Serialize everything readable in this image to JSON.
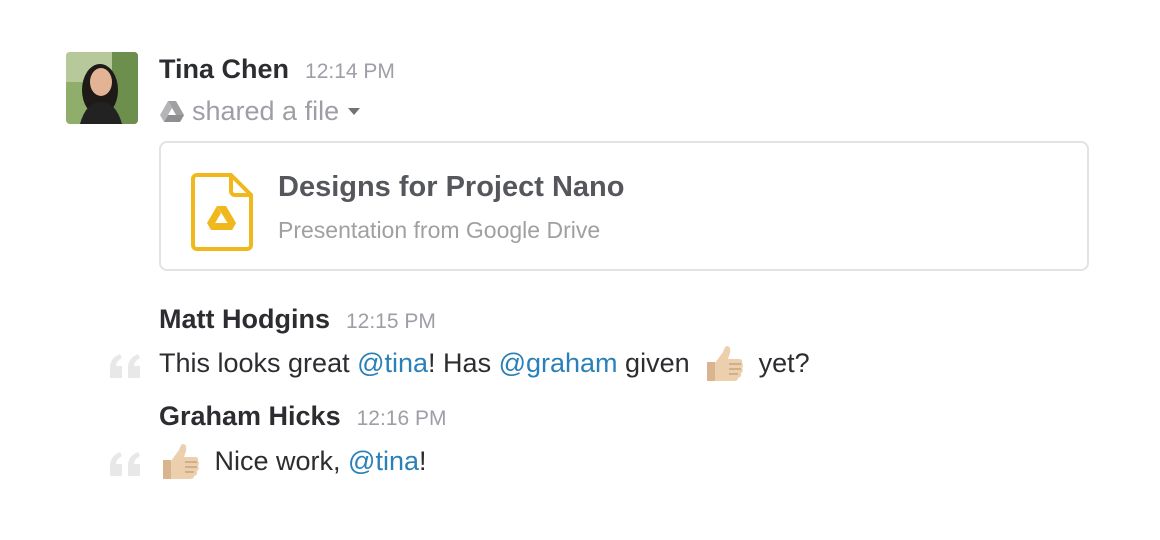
{
  "messages": [
    {
      "author": "Tina Chen",
      "time": "12:14 PM",
      "action": "shared a file",
      "file": {
        "title": "Designs for Project Nano",
        "subtitle": "Presentation from Google Drive"
      }
    },
    {
      "author": "Matt Hodgins",
      "time": "12:15 PM",
      "text": {
        "p1": "This looks great ",
        "m1": "@tina",
        "p2": "! Has ",
        "m2": "@graham",
        "p3": " given ",
        "p4": " yet?"
      }
    },
    {
      "author": "Graham Hicks",
      "time": "12:16 PM",
      "text": {
        "p1": " Nice work, ",
        "m1": "@tina",
        "p2": "!"
      }
    }
  ],
  "colors": {
    "mention": "#2a80b9",
    "drive_yellow": "#f1b81d",
    "timestamp": "#9e9ea6"
  },
  "icons": [
    "google-drive-icon",
    "caret-down-icon",
    "file-presentation-icon",
    "quote-icon",
    "thumbs-up-emoji"
  ]
}
